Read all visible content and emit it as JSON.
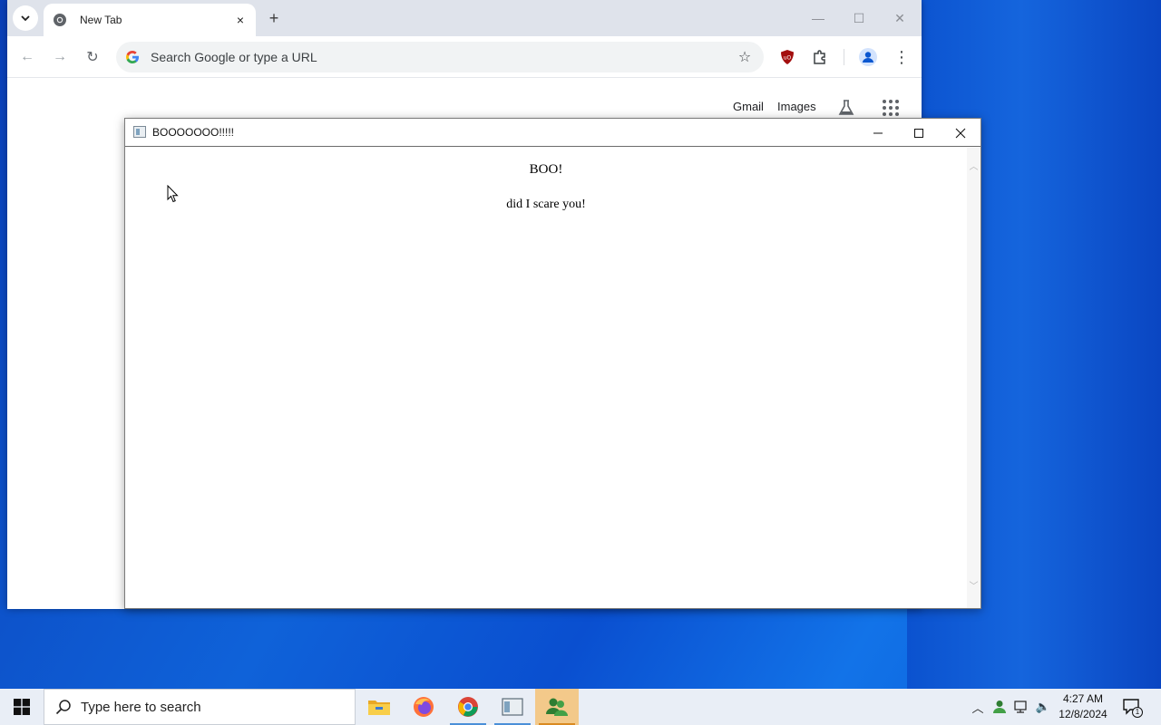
{
  "desktop": {
    "colors": {
      "desktop_blue": "#0f62d9",
      "taskbar": "#e9eef6"
    }
  },
  "chrome": {
    "tab": {
      "title": "New Tab",
      "favicon": "chrome-logo-icon",
      "close": "×"
    },
    "new_tab": "+",
    "window_controls": {
      "minimize": "—",
      "maximize": "☐",
      "close": "✕"
    },
    "toolbar": {
      "back": "←",
      "forward": "→",
      "reload": "↻",
      "omnibox_placeholder": "Search Google or type a URL",
      "bookmark": "☆",
      "menu": "⋮"
    },
    "ntp": {
      "gmail": "Gmail",
      "images": "Images"
    }
  },
  "popup": {
    "title": "BOOOOOOO!!!!!",
    "controls": {
      "minimize": "—",
      "maximize": "☐",
      "close": "✕"
    },
    "heading": "BOO!",
    "message": "did I scare you!",
    "scroll_up": "︿",
    "scroll_down": "﹀"
  },
  "taskbar": {
    "search_placeholder": "Type here to search",
    "apps": [
      "file-explorer-icon",
      "firefox-icon",
      "chrome-icon",
      "window-app-icon",
      "people-app-icon"
    ],
    "tray": {
      "chevron": "︿",
      "volume": "🔈"
    },
    "clock": {
      "time": "4:27 AM",
      "date": "12/8/2024"
    },
    "notification_count": "1"
  }
}
